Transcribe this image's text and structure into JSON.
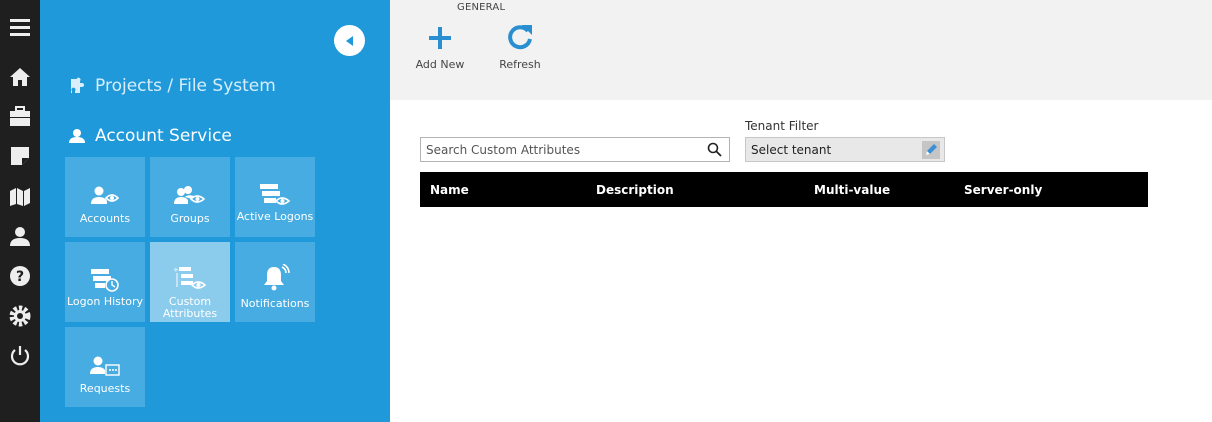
{
  "rail": {
    "icons": [
      "menu-icon",
      "home-icon",
      "briefcase-icon",
      "note-icon",
      "map-icon",
      "user-icon",
      "help-icon",
      "gear-icon",
      "power-icon"
    ]
  },
  "panel": {
    "breadcrumb": "Projects / File System",
    "section": "Account Service",
    "tiles": [
      {
        "label": "Accounts",
        "icon": "accounts-icon"
      },
      {
        "label": "Groups",
        "icon": "groups-icon"
      },
      {
        "label": "Active Logons",
        "icon": "active-logons-icon"
      },
      {
        "label": "Logon History",
        "icon": "logon-history-icon"
      },
      {
        "label": "Custom Attributes",
        "icon": "custom-attributes-icon",
        "active": true
      },
      {
        "label": "Notifications",
        "icon": "bell-icon"
      },
      {
        "label": "Requests",
        "icon": "requests-icon"
      }
    ]
  },
  "toolbar": {
    "group_label": "GENERAL",
    "add_label": "Add New",
    "refresh_label": "Refresh"
  },
  "search": {
    "placeholder": "Search Custom Attributes",
    "value": ""
  },
  "tenant": {
    "label": "Tenant Filter",
    "value": "Select tenant"
  },
  "grid": {
    "columns": [
      "Name",
      "Description",
      "Multi-value",
      "Server-only"
    ]
  },
  "colors": {
    "accent": "#1f99d9",
    "tile": "#47ace2",
    "tile_active": "#8bcbec",
    "rail": "#1f1f1f",
    "toolbar_icon": "#2a8fd0"
  }
}
